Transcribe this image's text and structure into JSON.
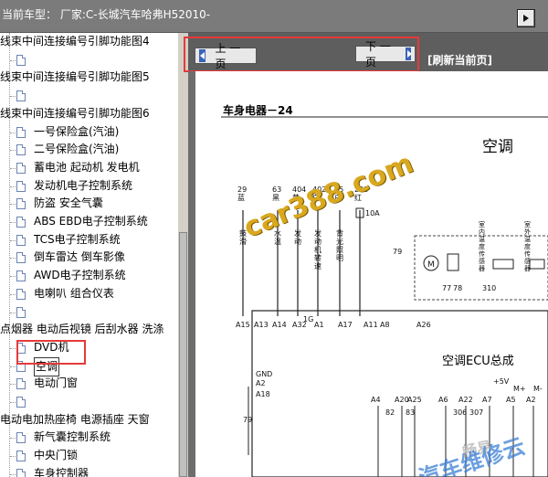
{
  "header": {
    "vehicle_label": "当前车型：",
    "vehicle_value": "厂家:C-长城汽车哈弗H52010-"
  },
  "tree": {
    "items": [
      {
        "label": "线束中间连接编号引脚功能图4",
        "icon": false
      },
      {
        "label": "",
        "icon": true
      },
      {
        "label": "线束中间连接编号引脚功能图5",
        "icon": false
      },
      {
        "label": "",
        "icon": true
      },
      {
        "label": "线束中间连接编号引脚功能图6",
        "icon": false
      },
      {
        "label": "一号保险盒(汽油)",
        "icon": true
      },
      {
        "label": "二号保险盒(汽油)",
        "icon": true
      },
      {
        "label": "蓄电池 起动机 发电机",
        "icon": true
      },
      {
        "label": "发动机电子控制系统",
        "icon": true
      },
      {
        "label": "防盗 安全气囊",
        "icon": true
      },
      {
        "label": "ABS EBD电子控制系统",
        "icon": true
      },
      {
        "label": "TCS电子控制系统",
        "icon": true
      },
      {
        "label": "倒车雷达 倒车影像",
        "icon": true
      },
      {
        "label": "AWD电子控制系统",
        "icon": true
      },
      {
        "label": "电喇叭 组合仪表",
        "icon": true
      },
      {
        "label": "",
        "icon": true
      },
      {
        "label": "点烟器 电动后视镜 后刮水器 洗涤",
        "icon": false
      },
      {
        "label": "DVD机",
        "icon": true
      },
      {
        "label": "空调",
        "icon": true
      },
      {
        "label": "电动门窗",
        "icon": true
      },
      {
        "label": "",
        "icon": true
      },
      {
        "label": "电动电加热座椅 电源插座 天窗",
        "icon": false
      },
      {
        "label": "新气囊控制系统",
        "icon": true
      },
      {
        "label": "中央门锁",
        "icon": true
      },
      {
        "label": "车身控制器",
        "icon": true
      },
      {
        "label": "倒车影像系统",
        "icon": true
      }
    ],
    "selected_index": 18
  },
  "nav": {
    "prev_label": "上 一 页",
    "next_label": "下 一 页",
    "refresh_label": "[刷新当前页]"
  },
  "diagram": {
    "section": "车身电器－24",
    "title": "空调",
    "ecu_label": "空调ECU总成",
    "top_wires": [
      {
        "code": "29\n蓝",
        "desc": "鼓\n滑"
      },
      {
        "code": "63\n黑",
        "desc": "水\n温"
      },
      {
        "code": "404\n黄",
        "desc": "发\n动"
      },
      {
        "code": "402\n白",
        "desc": "发\n动\n机\n转\n速"
      },
      {
        "code": "45\n白",
        "desc": "背\n光\n照\n明"
      },
      {
        "code": "298\n红",
        "desc": ""
      }
    ],
    "fuse": "10A",
    "pins_top": [
      "A15",
      "A13",
      "A14",
      "A32",
      "A1",
      "A17",
      "A11",
      "A8",
      "A26"
    ],
    "pins_bottom": [
      "A4",
      "A20",
      "A25",
      "A6",
      "A22",
      "A7",
      "A5",
      "A2"
    ],
    "side_labels": [
      "GND",
      "A2",
      "A18"
    ],
    "misc_labels": [
      "1G",
      "79",
      "77",
      "78",
      "310",
      "+5V",
      "M+",
      "M-",
      "室\n内\n温\n度\n传\n感\n器",
      "室\n外\n温\n度\n传\n感\n器",
      "82",
      "83",
      "306",
      "307",
      "86"
    ]
  },
  "watermarks": {
    "primary": "car388.com",
    "secondary": "畅易",
    "tertiary": "汽车维修云"
  },
  "colors": {
    "highlight_box": "#e53a3a",
    "nav_arrow": "#3a63b8",
    "watermark_gold": "#d9a81e"
  }
}
